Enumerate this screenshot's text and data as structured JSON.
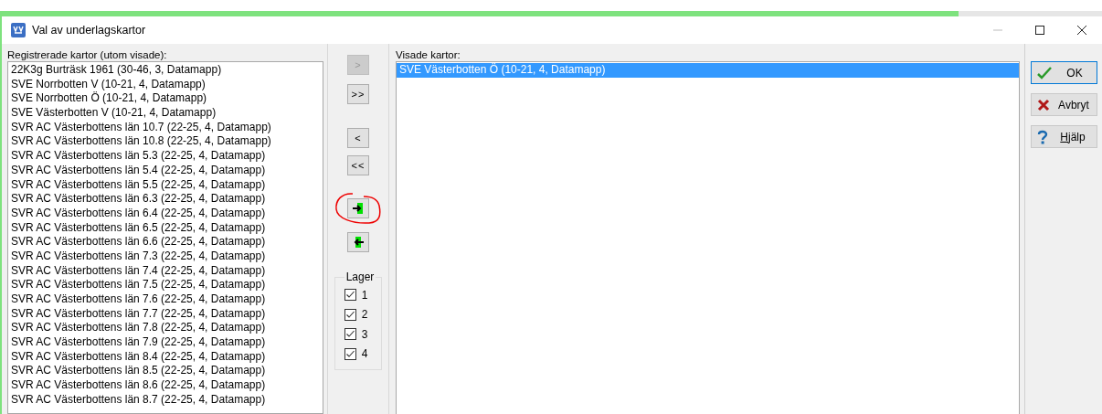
{
  "progress": {
    "level": 0.87
  },
  "window": {
    "title": "Val av underlagskartor"
  },
  "registered": {
    "label": "Registrerade kartor (utom visade):",
    "items": [
      {
        "text": "22K3g Burträsk 1961 (30-46, 3, Datamapp)",
        "selected": false
      },
      {
        "text": "SVE Norrbotten V (10-21, 4, Datamapp)",
        "selected": false
      },
      {
        "text": "SVE Norrbotten Ö (10-21, 4, Datamapp)",
        "selected": false
      },
      {
        "text": "SVE Västerbotten V (10-21, 4, Datamapp)",
        "selected": false
      },
      {
        "text": "SVR AC Västerbottens län 10.7 (22-25, 4, Datamapp)",
        "selected": false
      },
      {
        "text": "SVR AC Västerbottens län 10.8 (22-25, 4, Datamapp)",
        "selected": false
      },
      {
        "text": "SVR AC Västerbottens län 5.3 (22-25, 4, Datamapp)",
        "selected": false
      },
      {
        "text": "SVR AC Västerbottens län 5.4 (22-25, 4, Datamapp)",
        "selected": false
      },
      {
        "text": "SVR AC Västerbottens län 5.5 (22-25, 4, Datamapp)",
        "selected": false
      },
      {
        "text": "SVR AC Västerbottens län 6.3 (22-25, 4, Datamapp)",
        "selected": false
      },
      {
        "text": "SVR AC Västerbottens län 6.4 (22-25, 4, Datamapp)",
        "selected": false
      },
      {
        "text": "SVR AC Västerbottens län 6.5 (22-25, 4, Datamapp)",
        "selected": false
      },
      {
        "text": "SVR AC Västerbottens län 6.6 (22-25, 4, Datamapp)",
        "selected": false
      },
      {
        "text": "SVR AC Västerbottens län 7.3 (22-25, 4, Datamapp)",
        "selected": false
      },
      {
        "text": "SVR AC Västerbottens län 7.4 (22-25, 4, Datamapp)",
        "selected": false
      },
      {
        "text": "SVR AC Västerbottens län 7.5 (22-25, 4, Datamapp)",
        "selected": false
      },
      {
        "text": "SVR AC Västerbottens län 7.6 (22-25, 4, Datamapp)",
        "selected": false
      },
      {
        "text": "SVR AC Västerbottens län 7.7 (22-25, 4, Datamapp)",
        "selected": false
      },
      {
        "text": "SVR AC Västerbottens län 7.8 (22-25, 4, Datamapp)",
        "selected": false
      },
      {
        "text": "SVR AC Västerbottens län 7.9 (22-25, 4, Datamapp)",
        "selected": false
      },
      {
        "text": "SVR AC Västerbottens län 8.4 (22-25, 4, Datamapp)",
        "selected": false
      },
      {
        "text": "SVR AC Västerbottens län 8.5 (22-25, 4, Datamapp)",
        "selected": false
      },
      {
        "text": "SVR AC Västerbottens län 8.6 (22-25, 4, Datamapp)",
        "selected": false
      },
      {
        "text": "SVR AC Västerbottens län 8.7 (22-25, 4, Datamapp)",
        "selected": false
      }
    ]
  },
  "move_buttons": [
    {
      "kind": "text",
      "label": ">",
      "disabled": true
    },
    {
      "kind": "text",
      "label": ">>",
      "disabled": false
    },
    {
      "kind": "text",
      "label": "<",
      "disabled": false
    },
    {
      "kind": "text",
      "label": "<<",
      "disabled": false
    },
    {
      "kind": "arrow-right",
      "disabled": false,
      "circled": true
    },
    {
      "kind": "arrow-left",
      "disabled": false,
      "circled": false
    }
  ],
  "layers": {
    "label": "Lager",
    "items": [
      {
        "label": "1",
        "checked": true
      },
      {
        "label": "2",
        "checked": true
      },
      {
        "label": "3",
        "checked": true
      },
      {
        "label": "4",
        "checked": true
      }
    ]
  },
  "shown": {
    "label": "Visade kartor:",
    "items": [
      {
        "text": "SVE Västerbotten Ö (10-21, 4, Datamapp)",
        "selected": true
      }
    ]
  },
  "buttons": [
    {
      "kind": "ok",
      "label": "OK",
      "default": true
    },
    {
      "kind": "cancel",
      "label": "Avbryt",
      "default": false
    },
    {
      "kind": "help",
      "label": "Hjälp",
      "default": false
    }
  ]
}
